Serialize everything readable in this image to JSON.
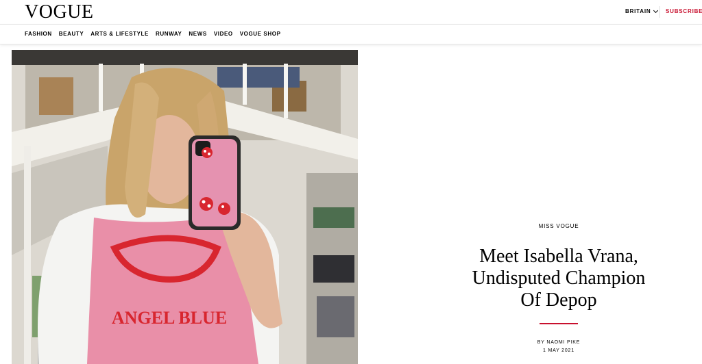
{
  "header": {
    "logo": "VOGUE",
    "edition": "BRITAIN",
    "subscribe": "SUBSCRIBE"
  },
  "nav": {
    "items": [
      "FASHION",
      "BEAUTY",
      "ARTS & LIFESTYLE",
      "RUNWAY",
      "NEWS",
      "VIDEO",
      "VOGUE SHOP"
    ]
  },
  "hero": {
    "sweater_text": "ANGEL BLUE"
  },
  "article": {
    "kicker": "MISS VOGUE",
    "headline_lines": [
      "Meet Isabella Vrana,",
      "Undisputed Champion",
      "Of Depop"
    ],
    "byline": "BY NAOMI PIKE",
    "date": "1 MAY 2021"
  },
  "colors": {
    "accent_red": "#c8102e",
    "sweater_pink": "#e98fa8",
    "phone_case_pink": "#e592b0"
  }
}
